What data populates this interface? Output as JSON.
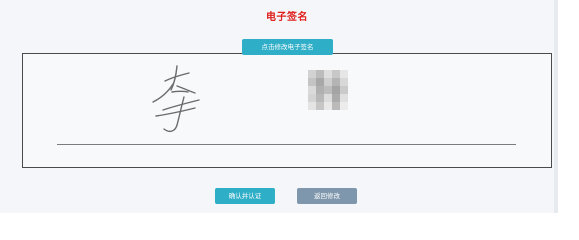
{
  "page": {
    "title": "电子签名"
  },
  "buttons": {
    "modify_signature": "点击修改电子签名",
    "confirm": "确认并认证",
    "return_modify": "返回修改"
  },
  "colors": {
    "title": "#e0201c",
    "primary_button": "#2eaec7",
    "secondary_button": "#7f97ad",
    "signature_stroke": "#6b6b6b"
  }
}
